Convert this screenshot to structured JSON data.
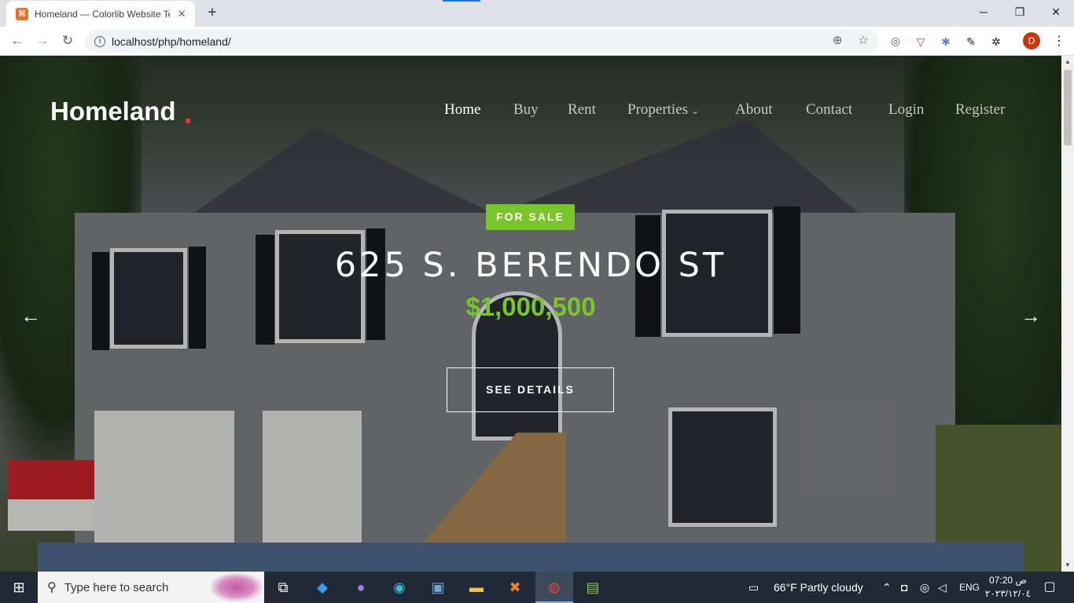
{
  "browser": {
    "tab_title": "Homeland — Colorlib Website Te",
    "tab_favicon": "⌘",
    "new_tab": "+",
    "url": "localhost/php/homeland/",
    "window_controls": {
      "minimize": "─",
      "restore": "❐",
      "close": "✕"
    },
    "nav": {
      "back": "←",
      "forward": "→",
      "reload": "↻"
    },
    "avatar_initial": "D"
  },
  "site": {
    "logo": "Homeland",
    "nav": {
      "home": "Home",
      "buy": "Buy",
      "rent": "Rent",
      "properties": "Properties",
      "about": "About",
      "contact": "Contact",
      "login": "Login",
      "register": "Register"
    },
    "hero": {
      "badge": "FOR SALE",
      "address": "625 S. BERENDO ST",
      "price": "$1,000,500",
      "button": "SEE DETAILS",
      "prev_arrow": "←",
      "next_arrow": "→"
    },
    "colors": {
      "accent_green": "#7ac52a",
      "logo_dot": "#e6392b",
      "search_strip": "#3d526f"
    }
  },
  "taskbar": {
    "search_placeholder": "Type here to search",
    "weather": "66°F  Partly cloudy",
    "language": "ENG",
    "time": "07:20 ص",
    "date": "٢٠٢٣/١٢/٠٤"
  }
}
